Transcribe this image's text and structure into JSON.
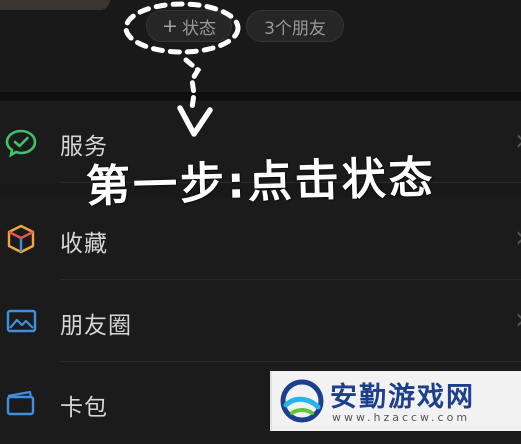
{
  "header": {
    "status_button": {
      "plus": "+",
      "label": "状态"
    },
    "friends_chip": {
      "label": "3个朋友"
    }
  },
  "menu": [
    {
      "label": "服务",
      "icon": "wechat-pay-icon",
      "color": "#3ec36b"
    },
    {
      "label": "收藏",
      "icon": "favorites-cube-icon",
      "color": "#f0a83a"
    },
    {
      "label": "朋友圈",
      "icon": "moments-photo-icon",
      "color": "#3d8fe0"
    },
    {
      "label": "卡包",
      "icon": "card-wallet-icon",
      "color": "#3d8fe0"
    }
  ],
  "annotation": {
    "text": "第一步:点击状态",
    "highlight": "dashed-circle-around-status",
    "arrow": "down-arrow"
  },
  "watermark": {
    "brand": "安勤游戏网",
    "url": "www.hzaccw.com",
    "brand_color": "#1c3f8e"
  }
}
